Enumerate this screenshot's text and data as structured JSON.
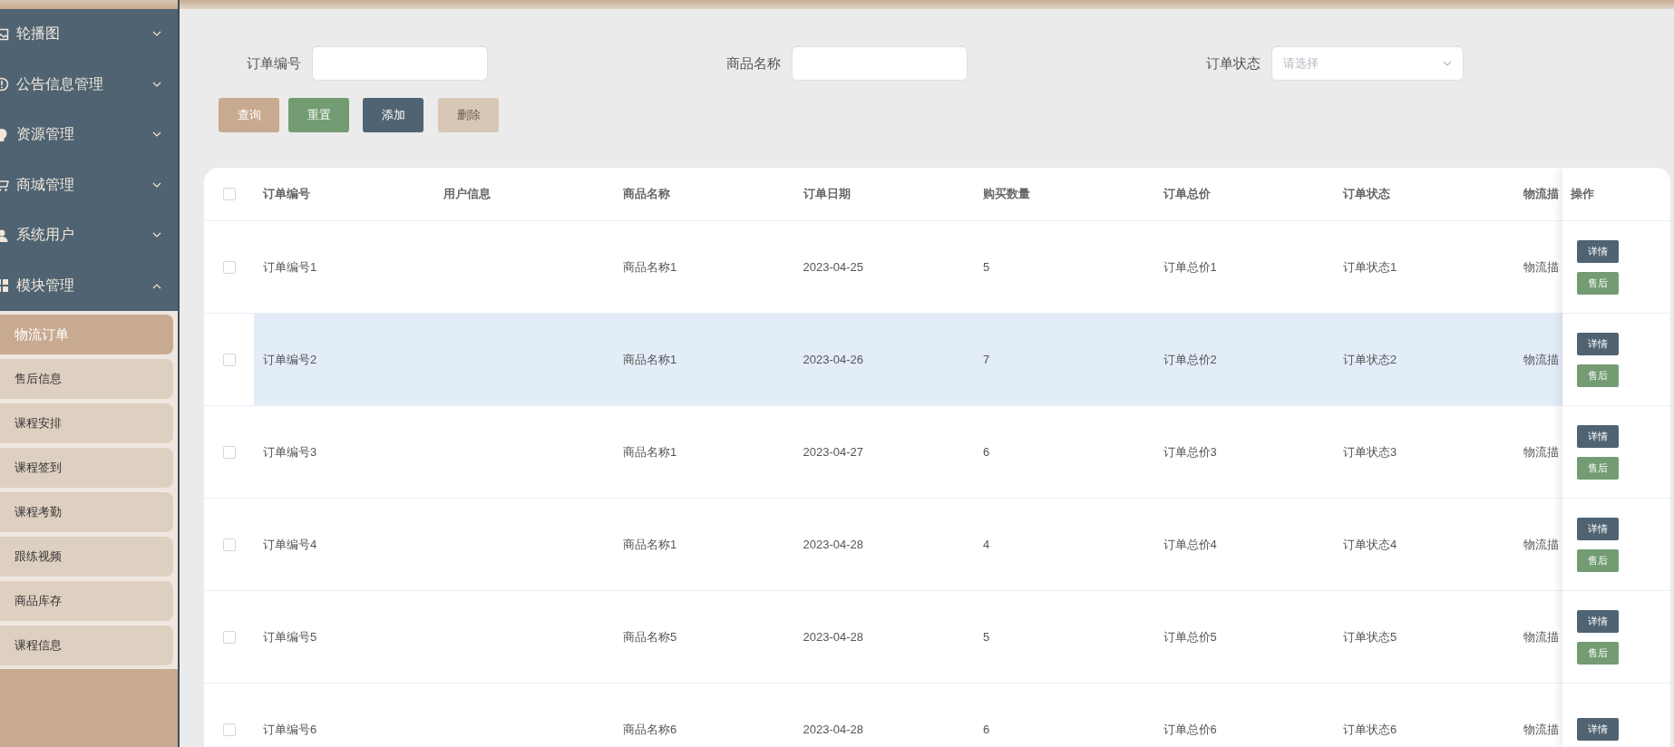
{
  "sidebar": {
    "menus": [
      {
        "label": "轮播图",
        "expanded": false
      },
      {
        "label": "公告信息管理",
        "expanded": false
      },
      {
        "label": "资源管理",
        "expanded": false
      },
      {
        "label": "商城管理",
        "expanded": false
      },
      {
        "label": "系统用户",
        "expanded": false
      },
      {
        "label": "模块管理",
        "expanded": true,
        "children": [
          {
            "label": "物流订单",
            "selected": true
          },
          {
            "label": "售后信息",
            "selected": false
          },
          {
            "label": "课程安排",
            "selected": false
          },
          {
            "label": "课程签到",
            "selected": false
          },
          {
            "label": "课程考勤",
            "selected": false
          },
          {
            "label": "跟练视频",
            "selected": false
          },
          {
            "label": "商品库存",
            "selected": false
          },
          {
            "label": "课程信息",
            "selected": false
          }
        ]
      }
    ]
  },
  "search": {
    "fields": [
      {
        "label": "订单编号",
        "kind": "input"
      },
      {
        "label": "商品名称",
        "kind": "input"
      },
      {
        "label": "订单状态",
        "kind": "select",
        "placeholder": "请选择"
      }
    ],
    "buttons": [
      {
        "label": "查询",
        "kind": "query",
        "disabled": false
      },
      {
        "label": "重置",
        "kind": "reset",
        "disabled": false
      },
      {
        "label": "添加",
        "kind": "add",
        "disabled": false
      },
      {
        "label": "删除",
        "kind": "delete",
        "disabled": true
      }
    ]
  },
  "table": {
    "columns": [
      "订单编号",
      "用户信息",
      "商品名称",
      "订单日期",
      "购买数量",
      "订单总价",
      "订单状态",
      "物流描"
    ],
    "action_column": "操作",
    "select_all_checked": false,
    "rows": [
      {
        "checked": false,
        "highlighted": false,
        "cells": [
          "订单编号1",
          "",
          "商品名称1",
          "2023-04-25",
          "5",
          "订单总价1",
          "订单状态1",
          "物流描"
        ],
        "actions": [
          "详情",
          "售后"
        ]
      },
      {
        "checked": false,
        "highlighted": true,
        "cells": [
          "订单编号2",
          "",
          "商品名称1",
          "2023-04-26",
          "7",
          "订单总价2",
          "订单状态2",
          "物流描"
        ],
        "actions": [
          "详情",
          "售后"
        ]
      },
      {
        "checked": false,
        "highlighted": false,
        "cells": [
          "订单编号3",
          "",
          "商品名称1",
          "2023-04-27",
          "6",
          "订单总价3",
          "订单状态3",
          "物流描"
        ],
        "actions": [
          "详情",
          "售后"
        ]
      },
      {
        "checked": false,
        "highlighted": false,
        "cells": [
          "订单编号4",
          "",
          "商品名称1",
          "2023-04-28",
          "4",
          "订单总价4",
          "订单状态4",
          "物流描"
        ],
        "actions": [
          "详情",
          "售后"
        ]
      },
      {
        "checked": false,
        "highlighted": false,
        "cells": [
          "订单编号5",
          "",
          "商品名称5",
          "2023-04-28",
          "5",
          "订单总价5",
          "订单状态5",
          "物流描"
        ],
        "actions": [
          "详情",
          "售后"
        ]
      },
      {
        "checked": false,
        "highlighted": false,
        "cells": [
          "订单编号6",
          "",
          "商品名称6",
          "2023-04-28",
          "6",
          "订单总价6",
          "订单状态6",
          "物流描"
        ],
        "actions": [
          "详情"
        ]
      }
    ]
  }
}
